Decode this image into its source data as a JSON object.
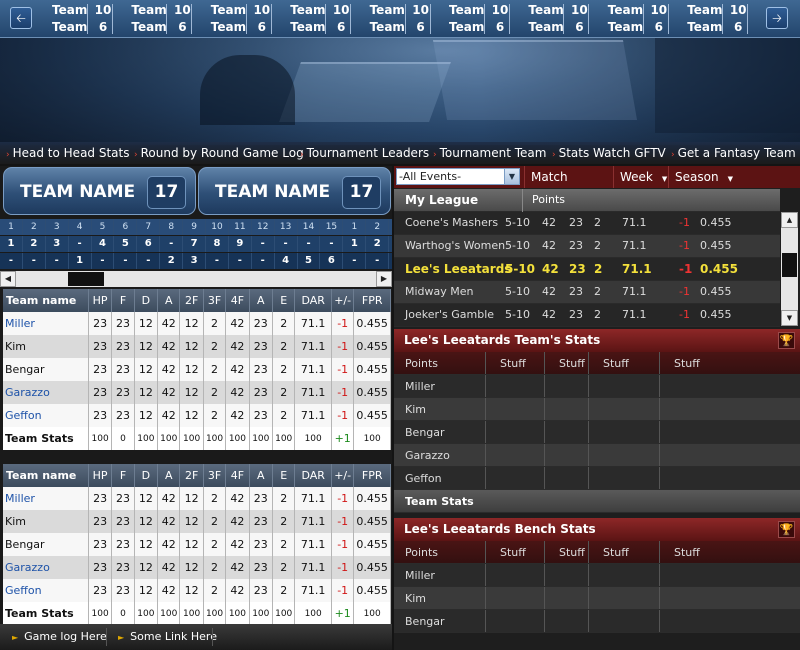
{
  "ticker": {
    "prev_icon": "arrow-left-icon",
    "next_icon": "arrow-right-icon",
    "games": [
      {
        "team_a": "Team",
        "score_a": "10",
        "team_b": "Team",
        "score_b": "6"
      },
      {
        "team_a": "Team",
        "score_a": "10",
        "team_b": "Team",
        "score_b": "6"
      },
      {
        "team_a": "Team",
        "score_a": "10",
        "team_b": "Team",
        "score_b": "6"
      },
      {
        "team_a": "Team",
        "score_a": "10",
        "team_b": "Team",
        "score_b": "6"
      },
      {
        "team_a": "Team",
        "score_a": "10",
        "team_b": "Team",
        "score_b": "6"
      },
      {
        "team_a": "Team",
        "score_a": "10",
        "team_b": "Team",
        "score_b": "6"
      },
      {
        "team_a": "Team",
        "score_a": "10",
        "team_b": "Team",
        "score_b": "6"
      },
      {
        "team_a": "Team",
        "score_a": "10",
        "team_b": "Team",
        "score_b": "6"
      },
      {
        "team_a": "Team",
        "score_a": "10",
        "team_b": "Team",
        "score_b": "6"
      }
    ]
  },
  "nav": [
    "Head to Head Stats",
    "Round by Round Game Log",
    "Tournament Leaders",
    "Tournament Team",
    "Stats Watch GFTV",
    "Get a Fantasy Team"
  ],
  "matchup": {
    "team1": {
      "name": "TEAM NAME",
      "score": "17"
    },
    "team2": {
      "name": "TEAM NAME",
      "score": "17"
    }
  },
  "rounds": {
    "numbers": [
      "1",
      "2",
      "3",
      "4",
      "5",
      "6",
      "7",
      "8",
      "9",
      "10",
      "11",
      "12",
      "13",
      "14",
      "15",
      "1",
      "2"
    ],
    "team1": [
      "1",
      "2",
      "3",
      "-",
      "4",
      "5",
      "6",
      "-",
      "7",
      "8",
      "9",
      "-",
      "-",
      "-",
      "-",
      "1",
      "2"
    ],
    "team2": [
      "-",
      "-",
      "-",
      "1",
      "-",
      "-",
      "-",
      "2",
      "3",
      "-",
      "-",
      "-",
      "4",
      "5",
      "6",
      "-",
      "-"
    ]
  },
  "stats_columns": [
    "Team name",
    "HP",
    "F",
    "D",
    "A",
    "2F",
    "3F",
    "4F",
    "A",
    "E",
    "DAR",
    "+/-",
    "FPR"
  ],
  "table1": {
    "rows": [
      {
        "name": "Miller",
        "vals": [
          "23",
          "23",
          "12",
          "42",
          "12",
          "2",
          "42",
          "23",
          "2",
          "71.1",
          "-1",
          "0.455"
        ]
      },
      {
        "name": "Kim",
        "vals": [
          "23",
          "23",
          "12",
          "42",
          "12",
          "2",
          "42",
          "23",
          "2",
          "71.1",
          "-1",
          "0.455"
        ]
      },
      {
        "name": "Bengar",
        "vals": [
          "23",
          "23",
          "12",
          "42",
          "12",
          "2",
          "42",
          "23",
          "2",
          "71.1",
          "-1",
          "0.455"
        ]
      },
      {
        "name": "Garazzo",
        "vals": [
          "23",
          "23",
          "12",
          "42",
          "12",
          "2",
          "42",
          "23",
          "2",
          "71.1",
          "-1",
          "0.455"
        ]
      },
      {
        "name": "Geffon",
        "vals": [
          "23",
          "23",
          "12",
          "42",
          "12",
          "2",
          "42",
          "23",
          "2",
          "71.1",
          "-1",
          "0.455"
        ]
      }
    ],
    "total": {
      "name": "Team Stats",
      "vals": [
        "100",
        "0",
        "100",
        "100",
        "100",
        "100",
        "100",
        "100",
        "100",
        "100",
        "+1",
        "100"
      ]
    }
  },
  "table2": {
    "rows": [
      {
        "name": "Miller",
        "vals": [
          "23",
          "23",
          "12",
          "42",
          "12",
          "2",
          "42",
          "23",
          "2",
          "71.1",
          "-1",
          "0.455"
        ]
      },
      {
        "name": "Kim",
        "vals": [
          "23",
          "23",
          "12",
          "42",
          "12",
          "2",
          "42",
          "23",
          "2",
          "71.1",
          "-1",
          "0.455"
        ]
      },
      {
        "name": "Bengar",
        "vals": [
          "23",
          "23",
          "12",
          "42",
          "12",
          "2",
          "42",
          "23",
          "2",
          "71.1",
          "-1",
          "0.455"
        ]
      },
      {
        "name": "Garazzo",
        "vals": [
          "23",
          "23",
          "12",
          "42",
          "12",
          "2",
          "42",
          "23",
          "2",
          "71.1",
          "-1",
          "0.455"
        ]
      },
      {
        "name": "Geffon",
        "vals": [
          "23",
          "23",
          "12",
          "42",
          "12",
          "2",
          "42",
          "23",
          "2",
          "71.1",
          "-1",
          "0.455"
        ]
      }
    ],
    "total": {
      "name": "Team Stats",
      "vals": [
        "100",
        "0",
        "100",
        "100",
        "100",
        "100",
        "100",
        "100",
        "100",
        "100",
        "+1",
        "100"
      ]
    }
  },
  "footer_links": [
    "Game log Here",
    "Some Link Here"
  ],
  "filters": {
    "events_value": "-All Events-",
    "buttons": [
      "Match Night",
      "Week",
      "Season"
    ]
  },
  "league": {
    "title": "My League",
    "points_label": "Points",
    "rows": [
      {
        "name": "Coene's Mashers",
        "vals": [
          "5-10",
          "42",
          "23",
          "2",
          "71.1",
          "-1",
          "0.455"
        ]
      },
      {
        "name": "Warthog's Women",
        "vals": [
          "5-10",
          "42",
          "23",
          "2",
          "71.1",
          "-1",
          "0.455"
        ]
      },
      {
        "name": "Lee's Leeatards",
        "vals": [
          "5-10",
          "42",
          "23",
          "2",
          "71.1",
          "-1",
          "0.455"
        ],
        "highlight": true
      },
      {
        "name": "Midway Men",
        "vals": [
          "5-10",
          "42",
          "23",
          "2",
          "71.1",
          "-1",
          "0.455"
        ]
      },
      {
        "name": "Joeker's Gamble",
        "vals": [
          "5-10",
          "42",
          "23",
          "2",
          "71.1",
          "-1",
          "0.455"
        ]
      }
    ]
  },
  "team_stats": {
    "title": "Lee's Leeatards  Team's  Stats",
    "points_label": "Points",
    "columns": [
      "Stuff",
      "Stuff",
      "Stuff",
      "Stuff"
    ],
    "rows": [
      "Miller",
      "Kim",
      "Bengar",
      "Garazzo",
      "Geffon"
    ],
    "total": "Team Stats"
  },
  "bench_stats": {
    "title": "Lee's Leeatards  Bench  Stats",
    "points_label": "Points",
    "columns": [
      "Stuff",
      "Stuff",
      "Stuff",
      "Stuff"
    ],
    "rows": [
      "Miller",
      "Kim",
      "Bengar"
    ]
  },
  "icons": {
    "trophy": "trophy-icon",
    "dropdown": "chevron-down-icon"
  }
}
